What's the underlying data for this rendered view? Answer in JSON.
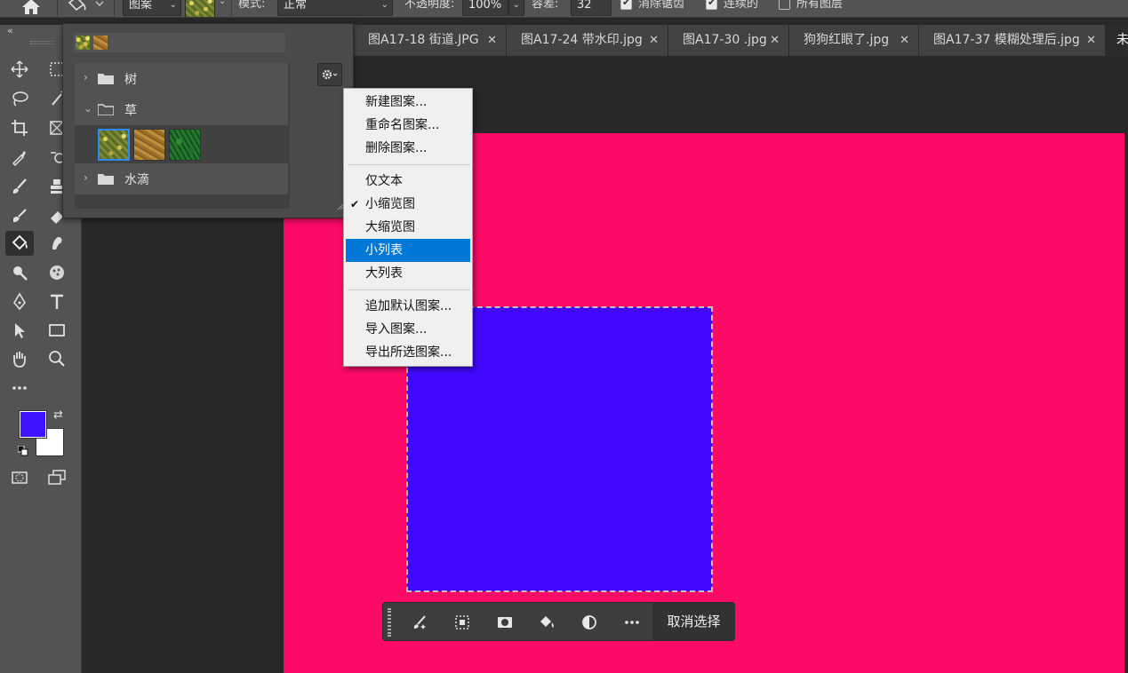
{
  "options_bar": {
    "source_dropdown": "图案",
    "mode_label": "模式:",
    "mode_value": "正常",
    "opacity_label": "不透明度:",
    "opacity_value": "100%",
    "tolerance_label": "容差:",
    "tolerance_value": "32",
    "antialias_label": "消除锯齿",
    "antialias_checked": true,
    "contiguous_label": "连续的",
    "contiguous_checked": true,
    "all_layers_label": "所有图层",
    "all_layers_checked": false
  },
  "pattern_panel": {
    "groups": [
      {
        "name": "树",
        "expanded": false
      },
      {
        "name": "草",
        "expanded": true
      },
      {
        "name": "水滴",
        "expanded": false
      }
    ]
  },
  "context_menu": {
    "items": [
      {
        "label": "新建图案..."
      },
      {
        "label": "重命名图案..."
      },
      {
        "label": "删除图案..."
      },
      {
        "label": "仅文本"
      },
      {
        "label": "小缩览图",
        "checked": true
      },
      {
        "label": "大缩览图"
      },
      {
        "label": "小列表",
        "highlighted": true
      },
      {
        "label": "大列表"
      },
      {
        "label": "追加默认图案..."
      },
      {
        "label": "导入图案..."
      },
      {
        "label": "导出所选图案..."
      }
    ]
  },
  "tabs": [
    {
      "label": "图A17-18 街道.JPG"
    },
    {
      "label": "图A17-24 带水印.jpg"
    },
    {
      "label": "图A17-30 .jpg"
    },
    {
      "label": "狗狗红眼了.jpg"
    },
    {
      "label": "图A17-37 模糊处理后.jpg"
    },
    {
      "label": "未"
    }
  ],
  "colors": {
    "foreground": "#4011ff",
    "background": "#ffffff",
    "canvas_fill": "#fb0a66",
    "selection_fill": "#4208ff",
    "menu_highlight": "#0078d7"
  },
  "taskbar": {
    "deselect_label": "取消选择"
  }
}
